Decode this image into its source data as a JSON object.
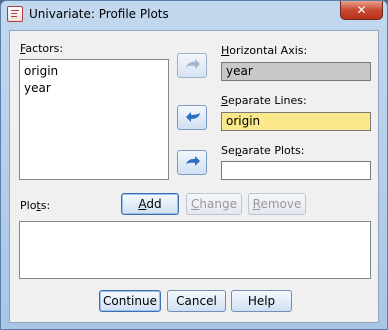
{
  "window": {
    "title": "Univariate: Profile Plots",
    "close_label": "✕"
  },
  "factors": {
    "label": "Factors:",
    "items": [
      "origin",
      "year"
    ]
  },
  "horizontal_axis": {
    "label": "Horizontal Axis:",
    "value": "year"
  },
  "separate_lines": {
    "label": "Separate Lines:",
    "value": "origin"
  },
  "separate_plots": {
    "label": "Separate Plots:",
    "value": ""
  },
  "plots": {
    "label": "Plots:",
    "add_label": "Add",
    "change_label": "Change",
    "remove_label": "Remove"
  },
  "footer": {
    "continue_label": "Continue",
    "cancel_label": "Cancel",
    "help_label": "Help"
  },
  "colors": {
    "disabled_field": "#c8c8c8",
    "active_field": "#fbe88a",
    "arrow_blue": "#2f6fc0"
  }
}
